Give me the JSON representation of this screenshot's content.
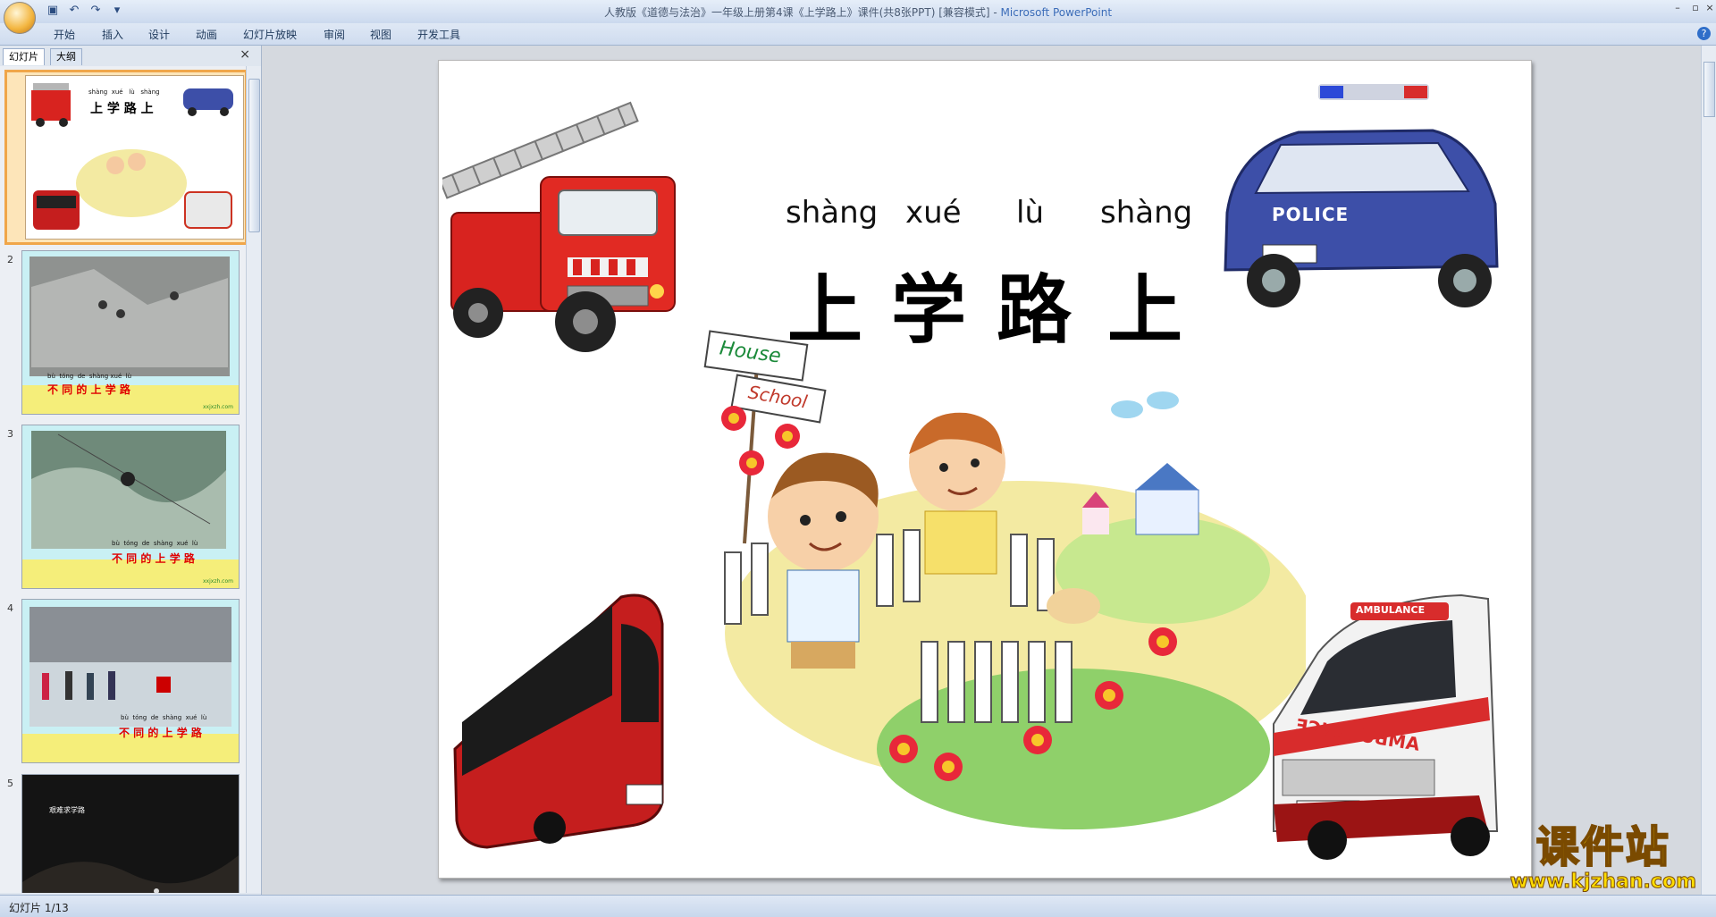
{
  "window": {
    "title": "人教版《道德与法治》一年级上册第4课《上学路上》课件(共8张PPT) [兼容模式]",
    "app_name": "Microsoft PowerPoint"
  },
  "window_controls": {
    "minimize": "–",
    "maximize": "▫",
    "close": "×"
  },
  "ribbon": {
    "tabs": [
      "开始",
      "插入",
      "设计",
      "动画",
      "幻灯片放映",
      "审阅",
      "视图",
      "开发工具"
    ]
  },
  "panel": {
    "tab_slides": "幻灯片",
    "tab_outline": "大纲",
    "close": "×",
    "thumbnails": [
      {
        "num": "1",
        "pinyin": "shàng  xué   lù   shàng",
        "title": "上 学 路 上"
      },
      {
        "num": "2",
        "pinyin": "bù  tóng  de  shàng xué  lù",
        "title": "不 同 的 上 学 路",
        "footer": "xxjxzh.com"
      },
      {
        "num": "3",
        "pinyin": "bù  tóng  de  shàng  xué  lù",
        "title": "不 同 的 上 学 路",
        "footer": "xxjxzh.com"
      },
      {
        "num": "4",
        "pinyin": "bù  tóng  de  shàng  xué  lù",
        "title": "不 同 的 上 学 路"
      },
      {
        "num": "5",
        "title": "艰难求学路"
      }
    ]
  },
  "slide": {
    "pinyin": [
      "shàng",
      "xué",
      "lù",
      "shàng"
    ],
    "title": [
      "上",
      "学",
      "路",
      "上"
    ],
    "sign_house": "House",
    "sign_school": "School",
    "police_text": "POLICE",
    "ambulance_text": "AMBULANCE"
  },
  "status": {
    "slide_counter": "幻灯片 1/13"
  },
  "watermark": {
    "cn": "课件站",
    "en": "www.kjzhan.com"
  },
  "colors": {
    "selected_border": "#f0a64a",
    "fire_red": "#d8231f",
    "police_blue": "#3d4fa8"
  }
}
